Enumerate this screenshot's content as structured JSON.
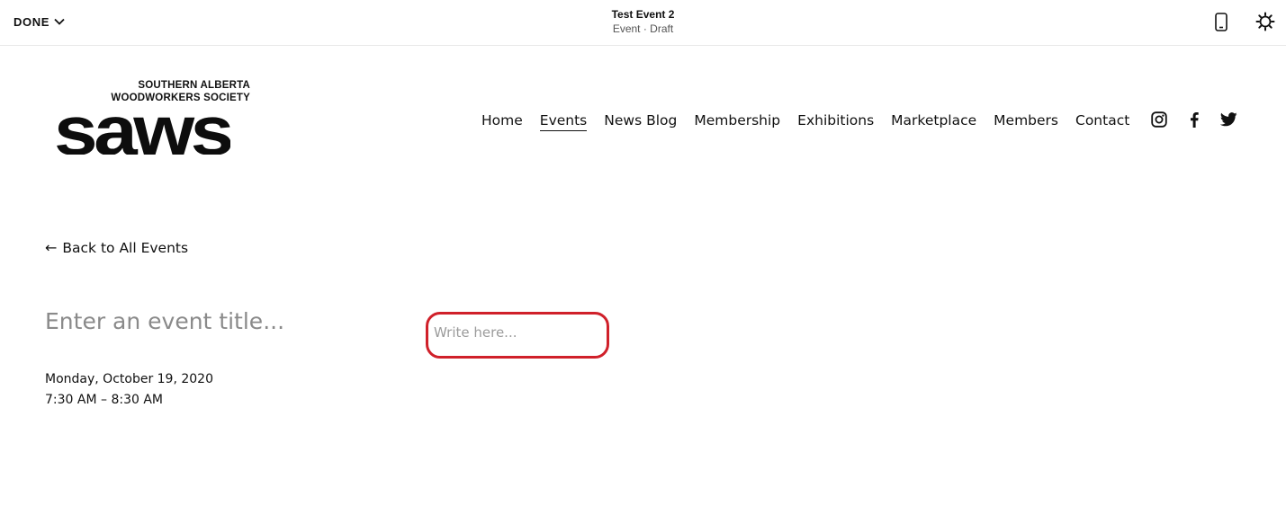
{
  "editor": {
    "done_label": "DONE",
    "doc_title": "Test Event 2",
    "doc_subtitle": "Event · Draft",
    "icons": [
      "chevron-down-icon",
      "mobile-preview-icon",
      "site-styles-icon"
    ]
  },
  "site": {
    "logo": {
      "line1": "SOUTHERN ALBERTA",
      "line2": "WOODWORKERS SOCIETY",
      "wordmark": "saws"
    },
    "nav": [
      {
        "label": "Home",
        "active": false
      },
      {
        "label": "Events",
        "active": true
      },
      {
        "label": "News Blog",
        "active": false
      },
      {
        "label": "Membership",
        "active": false
      },
      {
        "label": "Exhibitions",
        "active": false
      },
      {
        "label": "Marketplace",
        "active": false
      },
      {
        "label": "Members",
        "active": false
      },
      {
        "label": "Contact",
        "active": false
      }
    ],
    "social_icons": [
      "instagram-icon",
      "facebook-icon",
      "twitter-icon"
    ]
  },
  "event": {
    "back_label": "Back to All Events",
    "title_placeholder": "Enter an event title...",
    "date": "Monday, October 19, 2020",
    "time": "7:30 AM – 8:30 AM",
    "body_placeholder": "Write here..."
  },
  "colors": {
    "highlight": "#d0202a",
    "placeholder": "#8a8a8a",
    "text": "#111111"
  }
}
